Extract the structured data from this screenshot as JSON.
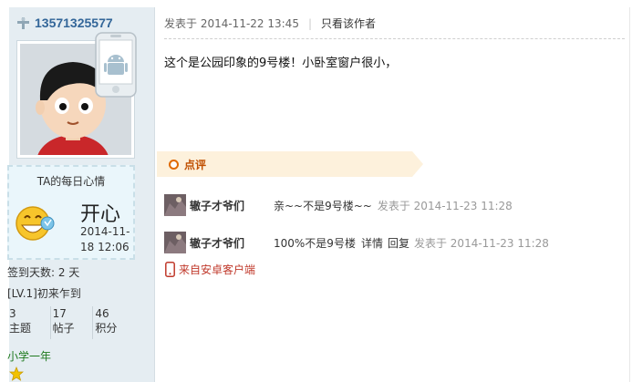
{
  "user": {
    "name": "13571325577",
    "mood_title": "TA的每日心情",
    "mood_value": "开心",
    "mood_date": "2014-11-18 12:06",
    "signin": "签到天数: 2 天",
    "level": "[LV.1]初来乍到",
    "stats": [
      {
        "value": "3",
        "label": "主题"
      },
      {
        "value": "17",
        "label": "帖子"
      },
      {
        "value": "46",
        "label": "积分"
      }
    ],
    "grade": "小学一年"
  },
  "post": {
    "posted_at": "发表于 2014-11-22 13:45",
    "only_author": "只看该作者",
    "content": "这个是公园印象的9号楼！小卧室窗户很小，"
  },
  "comments_header": "点评",
  "comments": [
    {
      "user": "辙子才爷们",
      "text": "亲~~不是9号楼~~",
      "detail": "",
      "reply": "",
      "time": "发表于 2014-11-23 11:28"
    },
    {
      "user": "辙子才爷们",
      "text": "100%不是9号楼",
      "detail": "详情",
      "reply": "回复",
      "time": "发表于 2014-11-23 11:28"
    }
  ],
  "from_mobile": "来自安卓客户端",
  "colors": {
    "sidebar_bg": "#e5edf2",
    "username": "#336699",
    "comment_accent": "#e06a00",
    "mobile_link": "#c0392b",
    "grade": "#1e7a1e"
  }
}
